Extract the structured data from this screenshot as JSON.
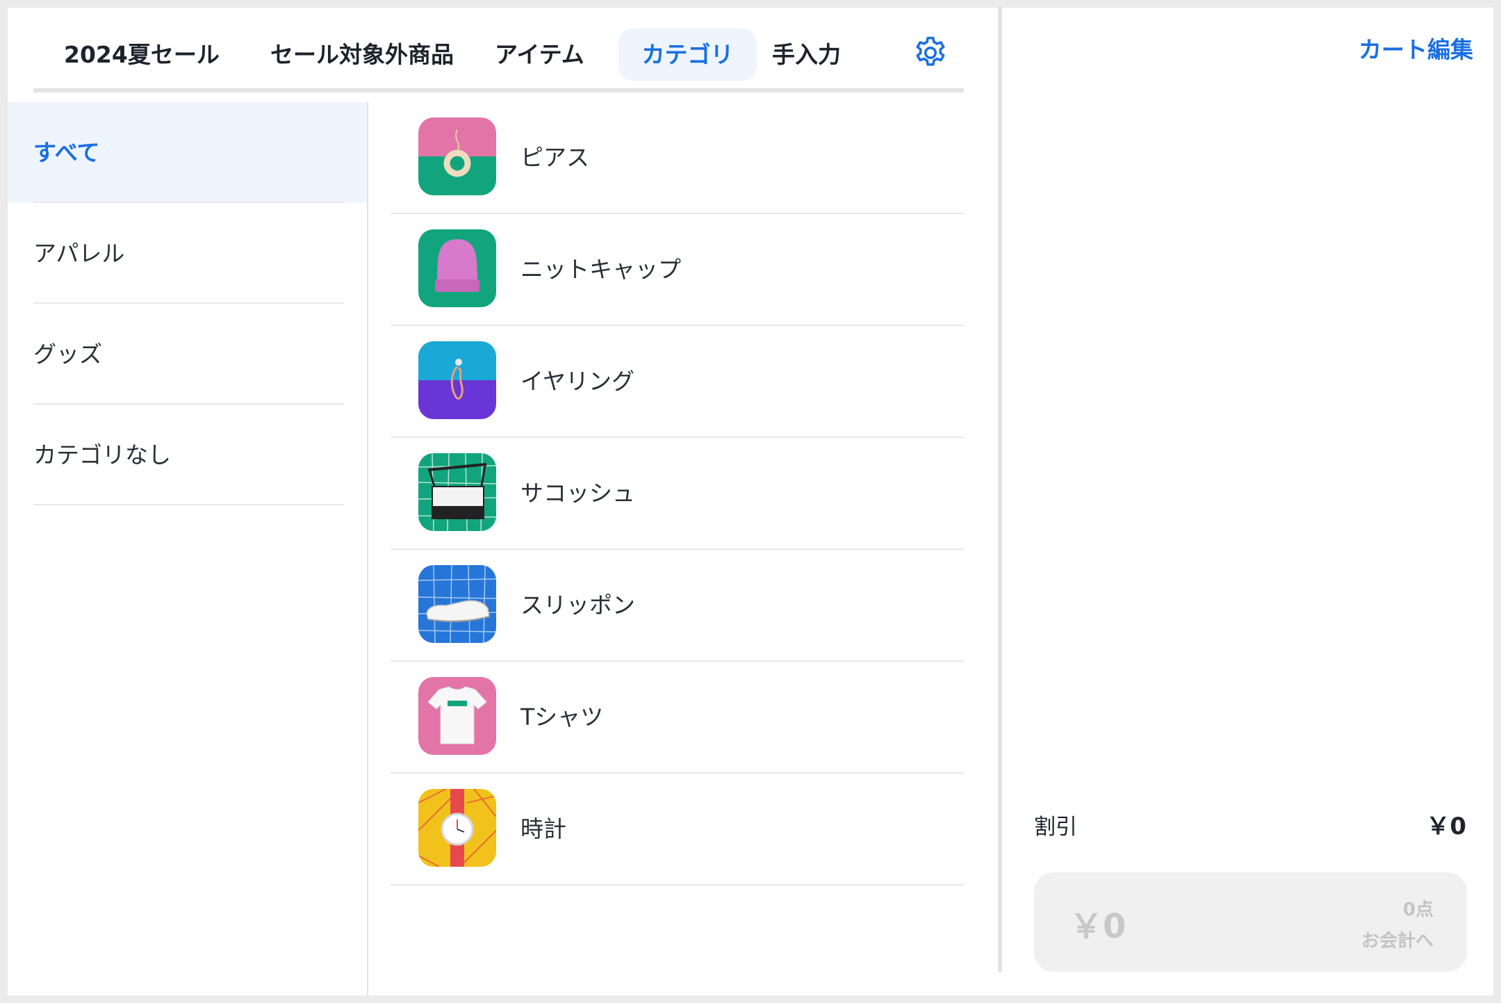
{
  "tabs": {
    "sale": "2024夏セール",
    "non_sale": "セール対象外商品",
    "items": "アイテム",
    "category": "カテゴリ",
    "manual": "手入力"
  },
  "categories": [
    {
      "label": "すべて",
      "active": true
    },
    {
      "label": "アパレル",
      "active": false
    },
    {
      "label": "グッズ",
      "active": false
    },
    {
      "label": "カテゴリなし",
      "active": false
    }
  ],
  "items": [
    {
      "name": "ピアス",
      "icon": "pierced-earring-image"
    },
    {
      "name": "ニットキャップ",
      "icon": "knit-cap-image"
    },
    {
      "name": "イヤリング",
      "icon": "earring-image"
    },
    {
      "name": "サコッシュ",
      "icon": "sacoche-bag-image"
    },
    {
      "name": "スリッポン",
      "icon": "slip-on-shoe-image"
    },
    {
      "name": "Tシャツ",
      "icon": "t-shirt-image"
    },
    {
      "name": "時計",
      "icon": "watch-image"
    }
  ],
  "cart": {
    "edit_label": "カート編集",
    "discount_label": "割引",
    "discount_value": "￥0",
    "checkout_total": "￥0",
    "checkout_count": "0点",
    "checkout_label": "お会計へ"
  },
  "colors": {
    "accent": "#1a6fe0",
    "active_bg": "#eef5fe"
  }
}
